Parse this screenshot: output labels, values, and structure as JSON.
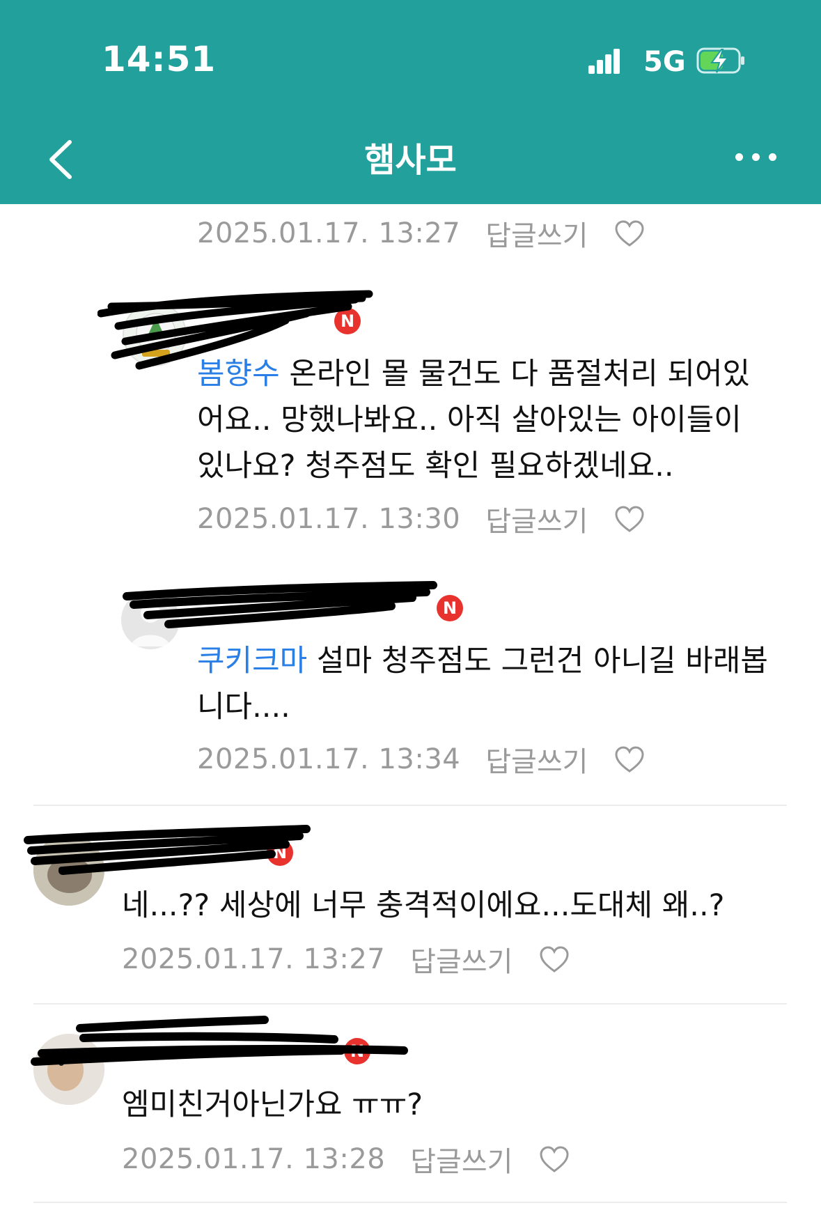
{
  "status_bar": {
    "time": "14:51",
    "network": "5G"
  },
  "header": {
    "title": "햄사모",
    "back_icon": "chevron-left-icon",
    "more_icon": "more-dots-icon"
  },
  "colors": {
    "header_bg": "#21a09c",
    "mention": "#2a7fe6",
    "meta": "#9a9a9a",
    "new_badge": "#e8322d"
  },
  "reply_label": "답글쓰기",
  "comments": [
    {
      "date": "2025.01.17. 13:27"
    },
    {
      "badge": "N",
      "mention": "봄향수",
      "lines": [
        " 온라인 몰 물건도 다 품절처리 되어있",
        "어요.. 망했나봐요.. 아직 살아있는 아이들이",
        "있나요? 청주점도 확인 필요하겠네요.."
      ],
      "date": "2025.01.17. 13:30"
    },
    {
      "badge": "N",
      "mention": "쿠키크마",
      "lines": [
        " 설마 청주점도 그런건 아니길 바래봅",
        "니다...."
      ],
      "date": "2025.01.17. 13:34"
    },
    {
      "badge": "N",
      "text": "네...?? 세상에 너무 충격적이에요...도대체 왜..?",
      "date": "2025.01.17. 13:27"
    },
    {
      "badge": "N",
      "text": "엠미친거아닌가요 ㅠㅠ?",
      "date": "2025.01.17. 13:28"
    }
  ]
}
